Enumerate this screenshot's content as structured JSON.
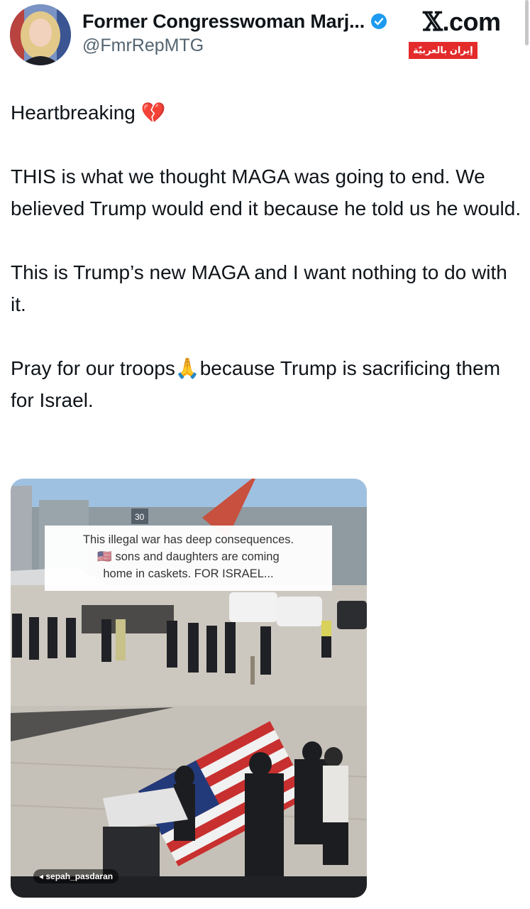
{
  "header": {
    "display_name": "Former Congresswoman Marj...",
    "handle": "@FmrRepMTG",
    "site_prefix": "𝕏",
    "site_suffix": ".com",
    "badge_left": "إيران بالعربيّة"
  },
  "tweet": {
    "p1": "Heartbreaking 💔",
    "p2": "THIS is what we thought MAGA was going to end. We believed Trump would end it because he told us he would.",
    "p3": "This is Trump’s new MAGA and I want nothing to do with it.",
    "p4": "Pray for our troops🙏because Trump is sacrificing them for Israel."
  },
  "media": {
    "caption_line1": "This illegal war has deep consequences.",
    "caption_line2": "🇺🇸 sons and daughters are coming",
    "caption_line3": "home in caskets. FOR ISRAEL...",
    "watermark": "◂ sepah_pasdaran",
    "sign": "30"
  },
  "colors": {
    "text": "#0f1419",
    "secondary": "#536471",
    "verified": "#1d9bf0",
    "badge_green": "#1ea24a",
    "badge_red": "#e42b2b"
  },
  "icons": [
    "verified-badge-icon",
    "telegram-icon"
  ]
}
